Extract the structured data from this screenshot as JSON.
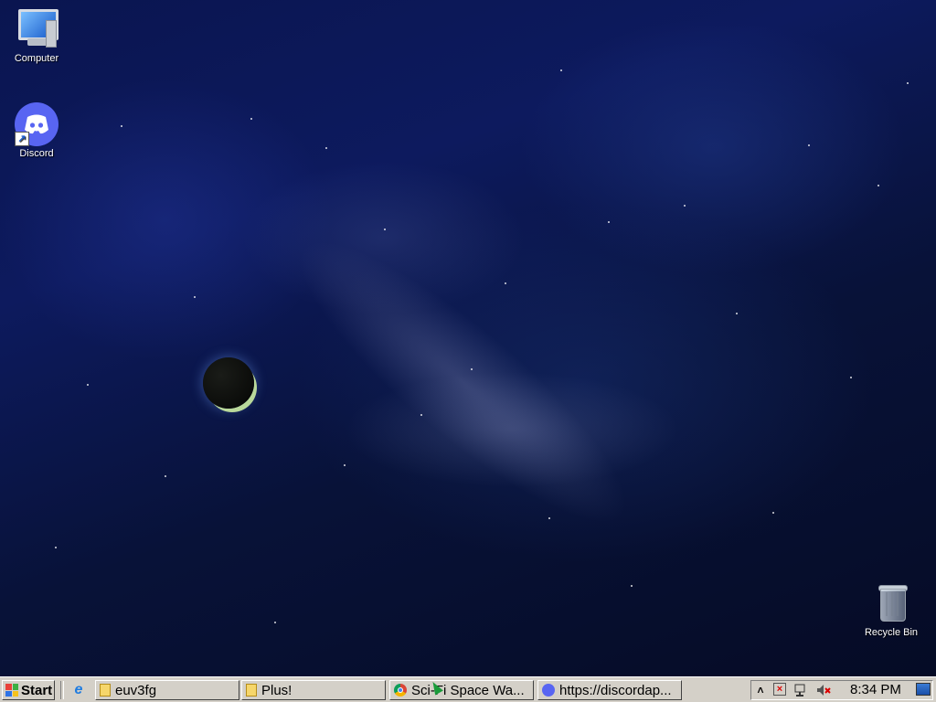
{
  "desktop": {
    "icons": [
      {
        "label": "Computer",
        "icon": "computer-icon"
      },
      {
        "label": "Discord",
        "icon": "discord-icon"
      },
      {
        "label": "Recycle Bin",
        "icon": "recycle-bin-icon"
      }
    ]
  },
  "taskbar": {
    "start_label": "Start",
    "quick_launch": [
      {
        "icon": "internet-explorer-icon",
        "glyph": "e"
      }
    ],
    "tasks": [
      {
        "label": "euv3fg",
        "icon": "folder-icon"
      },
      {
        "label": "Plus!",
        "icon": "folder-icon"
      },
      {
        "label": "Sci-Fi Space Wa...",
        "icon": "chrome-icon"
      },
      {
        "label": "https://discordap...",
        "icon": "discord-icon"
      }
    ],
    "tray": {
      "show_hidden_glyph": "˄",
      "clock": "8:34 PM",
      "icons": [
        "action-center-flag-icon",
        "network-icon",
        "volume-muted-icon",
        "show-desktop-icon"
      ]
    }
  }
}
